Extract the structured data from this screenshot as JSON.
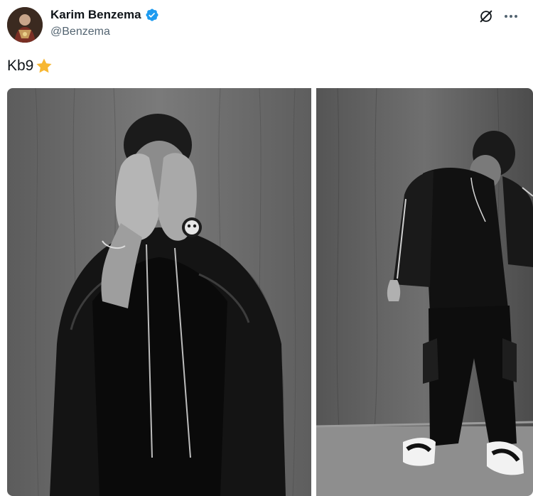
{
  "author": {
    "name": "Karim Benzema",
    "handle": "@Benzema",
    "avatar_icon": "avatar-portrait",
    "verified": true,
    "verified_color": "#1d9bf0"
  },
  "actions": {
    "grok_icon": "grok-icon",
    "more_icon": "more-options-icon"
  },
  "tweet": {
    "text": "Kb9",
    "emoji": "star-icon",
    "emoji_color": "#f7b733"
  },
  "media": [
    {
      "kind": "photo",
      "description_icon": "photo-portrait-hands-over-face"
    },
    {
      "kind": "photo",
      "description_icon": "photo-full-body-adjusting-jacket"
    }
  ],
  "colors": {
    "text_primary": "#0f1419",
    "text_secondary": "#536471",
    "background": "#ffffff"
  }
}
